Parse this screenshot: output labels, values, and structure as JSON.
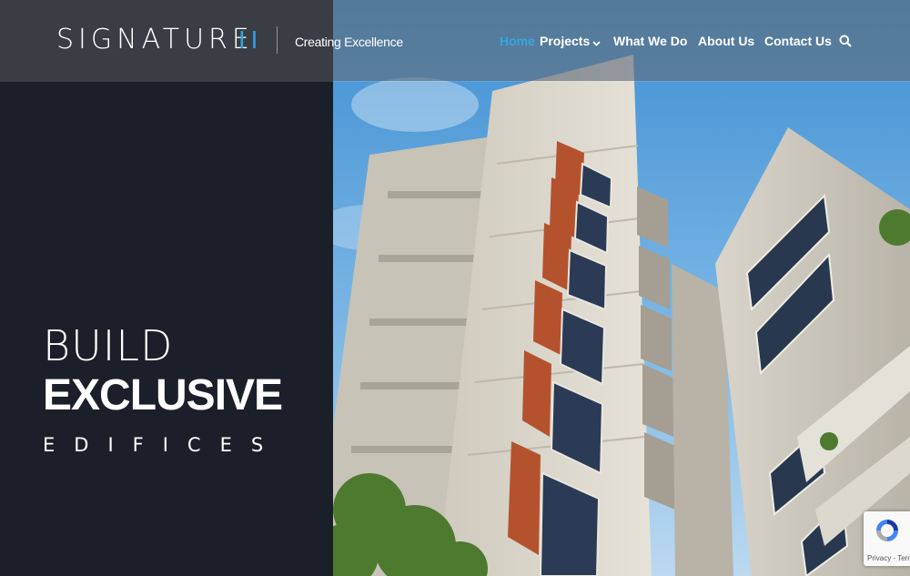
{
  "brand": {
    "name": "SIGNATURE",
    "mark": "II",
    "tagline": "Creating Excellence"
  },
  "nav": {
    "items": [
      {
        "label": "Home",
        "active": true
      },
      {
        "label": "Projects",
        "has_dropdown": true
      },
      {
        "label": "What We Do"
      },
      {
        "label": "About Us"
      },
      {
        "label": "Contact Us"
      }
    ],
    "search_icon": "search-icon"
  },
  "hero": {
    "line1": "BUILD",
    "line2": "EXCLUSIVE",
    "line3": "EDIFICES"
  },
  "recaptcha": {
    "links": "Privacy - Terms"
  },
  "colors": {
    "accent": "#34a8e0",
    "panel": "#1b1f29",
    "header_left": "#3e4046",
    "sky": "#5aa3d8",
    "brick": "#b5522e"
  }
}
